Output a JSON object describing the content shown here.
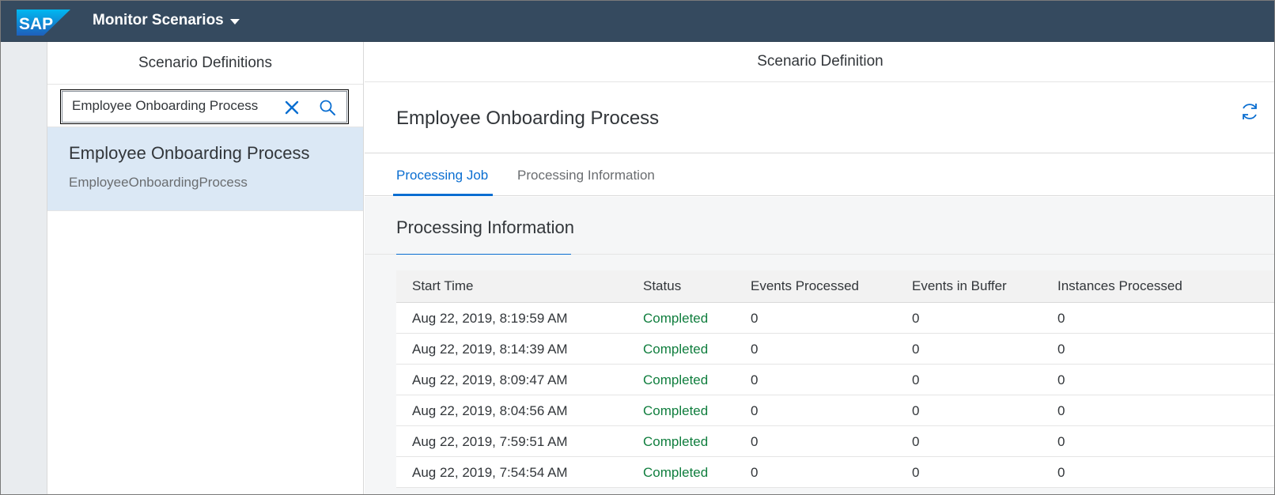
{
  "shell": {
    "logo_text": "SAP",
    "app_title": "Monitor Scenarios",
    "brand_color": "#354a5f"
  },
  "master": {
    "title": "Scenario Definitions",
    "search": {
      "value": "Employee Onboarding Process",
      "clear_icon": "close-icon",
      "search_icon": "search-icon"
    },
    "items": [
      {
        "title": "Employee Onboarding Process",
        "subtitle": "EmployeeOnboardingProcess",
        "selected": true
      }
    ]
  },
  "detail": {
    "title": "Scenario Definition",
    "object_title": "Employee Onboarding Process",
    "refresh_icon": "refresh-icon",
    "tabs": [
      {
        "label": "Processing Job",
        "active": true
      },
      {
        "label": "Processing Information",
        "active": false
      }
    ],
    "section_title": "Processing Information",
    "table": {
      "columns": [
        "Start Time",
        "Status",
        "Events Processed",
        "Events in Buffer",
        "Instances Processed"
      ],
      "rows": [
        [
          "Aug 22, 2019, 8:19:59 AM",
          "Completed",
          "0",
          "0",
          "0"
        ],
        [
          "Aug 22, 2019, 8:14:39 AM",
          "Completed",
          "0",
          "0",
          "0"
        ],
        [
          "Aug 22, 2019, 8:09:47 AM",
          "Completed",
          "0",
          "0",
          "0"
        ],
        [
          "Aug 22, 2019, 8:04:56 AM",
          "Completed",
          "0",
          "0",
          "0"
        ],
        [
          "Aug 22, 2019, 7:59:51 AM",
          "Completed",
          "0",
          "0",
          "0"
        ],
        [
          "Aug 22, 2019, 7:54:54 AM",
          "Completed",
          "0",
          "0",
          "0"
        ]
      ]
    },
    "status_color": "#107e3e",
    "accent_color": "#0a6ed1"
  }
}
